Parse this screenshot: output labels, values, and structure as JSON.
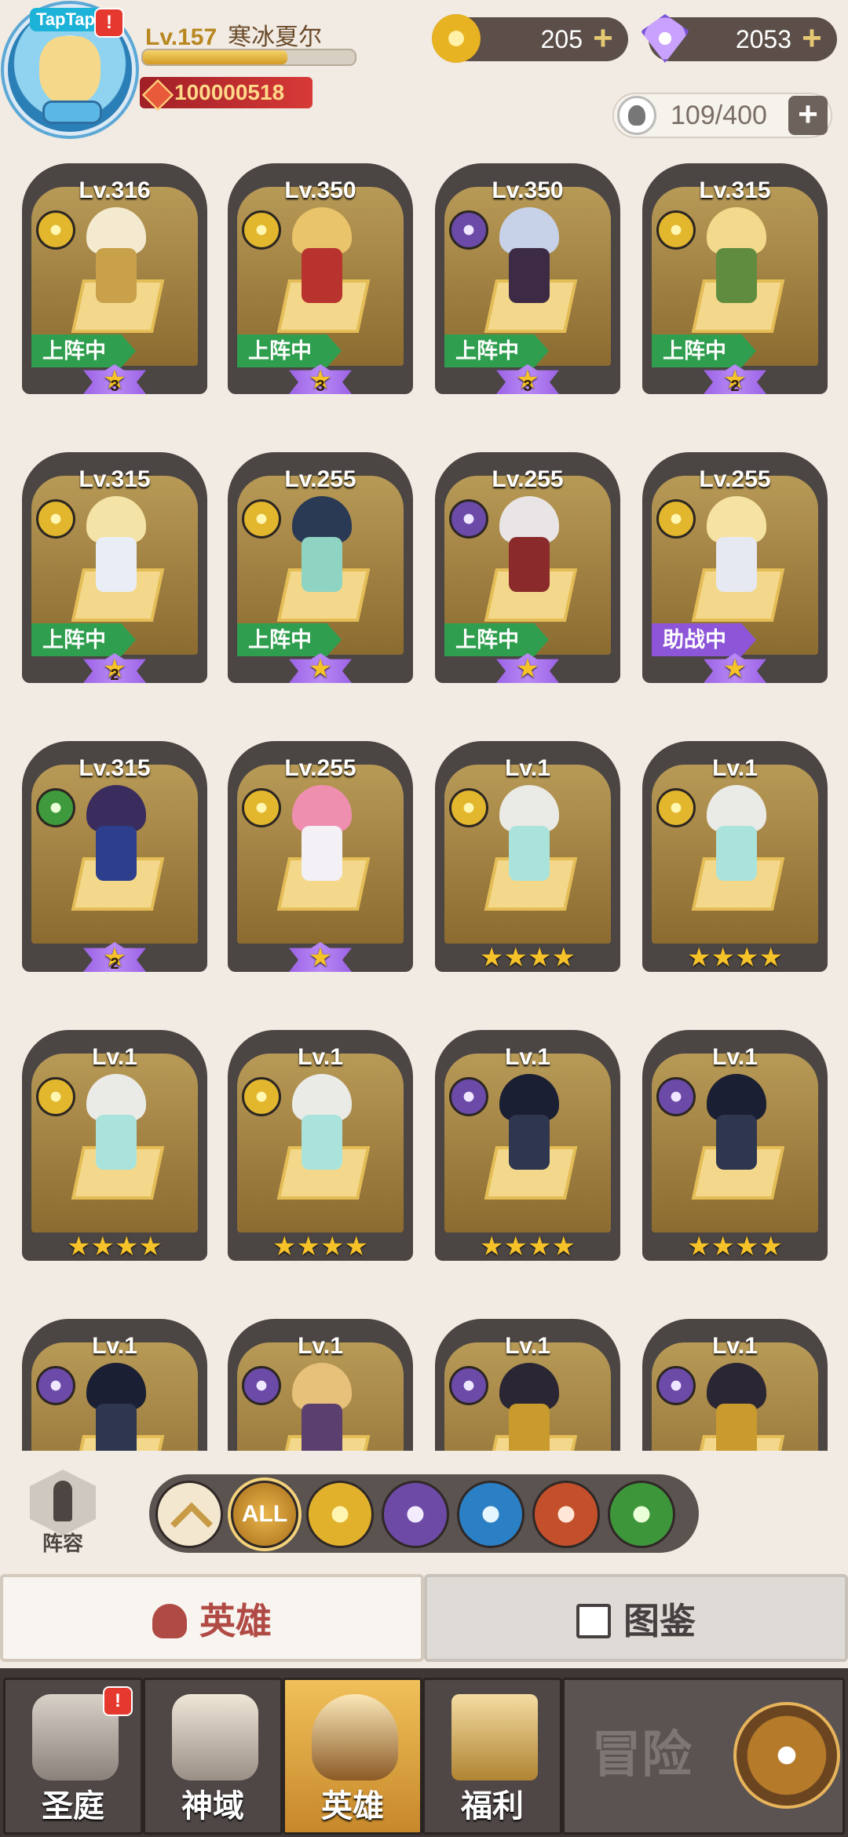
{
  "header": {
    "badge": "TapTap",
    "alert": "!",
    "level": "Lv.157",
    "player_name": "寒冰夏尔",
    "xp_fraction": 0.68,
    "combat_power": "100000518",
    "gold": "205",
    "diamonds": "2053",
    "hero_slots": "109/400",
    "plus": "+"
  },
  "heroes": [
    {
      "level": "Lv.316",
      "faction": "holy",
      "status": "上阵中",
      "status_type": "deploy",
      "star_type": "purple",
      "stars": "3",
      "hair": "#f3ead0",
      "body": "#c9a14a"
    },
    {
      "level": "Lv.350",
      "faction": "holy",
      "status": "上阵中",
      "status_type": "deploy",
      "star_type": "purple",
      "stars": "3",
      "hair": "#e9c46a",
      "body": "#b8322e"
    },
    {
      "level": "Lv.350",
      "faction": "dark",
      "status": "上阵中",
      "status_type": "deploy",
      "star_type": "purple",
      "stars": "3",
      "hair": "#c7d1e8",
      "body": "#3d2b46"
    },
    {
      "level": "Lv.315",
      "faction": "holy",
      "status": "上阵中",
      "status_type": "deploy",
      "star_type": "purple",
      "stars": "2",
      "hair": "#f2d98c",
      "body": "#5f8c3f"
    },
    {
      "level": "Lv.315",
      "faction": "holy",
      "status": "上阵中",
      "status_type": "deploy",
      "star_type": "purple",
      "stars": "2",
      "hair": "#f4e3a6",
      "body": "#e9edf6"
    },
    {
      "level": "Lv.255",
      "faction": "holy",
      "status": "上阵中",
      "status_type": "deploy",
      "star_type": "purple",
      "stars": "★",
      "hair": "#2a3a55",
      "body": "#8fd3c2"
    },
    {
      "level": "Lv.255",
      "faction": "dark",
      "status": "上阵中",
      "status_type": "deploy",
      "star_type": "purple",
      "stars": "★",
      "hair": "#e9e4e6",
      "body": "#8a2a2a"
    },
    {
      "level": "Lv.255",
      "faction": "holy",
      "status": "助战中",
      "status_type": "assist",
      "star_type": "purple",
      "stars": "★",
      "hair": "#f6e3a4",
      "body": "#e6e9f2"
    },
    {
      "level": "Lv.315",
      "faction": "nature",
      "status": "",
      "status_type": "",
      "star_type": "purple",
      "stars": "2",
      "hair": "#3a2d5e",
      "body": "#2c3e8c"
    },
    {
      "level": "Lv.255",
      "faction": "holy",
      "status": "",
      "status_type": "",
      "star_type": "purple",
      "stars": "★",
      "hair": "#ef8fb0",
      "body": "#f3f0f6"
    },
    {
      "level": "Lv.1",
      "faction": "holy",
      "status": "",
      "status_type": "",
      "star_type": "gold",
      "stars": "★★★★",
      "hair": "#eaeae6",
      "body": "#a9e3dc"
    },
    {
      "level": "Lv.1",
      "faction": "holy",
      "status": "",
      "status_type": "",
      "star_type": "gold",
      "stars": "★★★★",
      "hair": "#eaeae6",
      "body": "#a9e3dc"
    },
    {
      "level": "Lv.1",
      "faction": "holy",
      "status": "",
      "status_type": "",
      "star_type": "gold",
      "stars": "★★★★",
      "hair": "#eaeae6",
      "body": "#a9e3dc"
    },
    {
      "level": "Lv.1",
      "faction": "holy",
      "status": "",
      "status_type": "",
      "star_type": "gold",
      "stars": "★★★★",
      "hair": "#eaeae6",
      "body": "#a9e3dc"
    },
    {
      "level": "Lv.1",
      "faction": "dark",
      "status": "",
      "status_type": "",
      "star_type": "gold",
      "stars": "★★★★",
      "hair": "#1b1f33",
      "body": "#2e3650"
    },
    {
      "level": "Lv.1",
      "faction": "dark",
      "status": "",
      "status_type": "",
      "star_type": "gold",
      "stars": "★★★★",
      "hair": "#1b1f33",
      "body": "#2e3650"
    },
    {
      "level": "Lv.1",
      "faction": "dark",
      "status": "",
      "status_type": "",
      "star_type": "",
      "stars": "",
      "hair": "#1b1f33",
      "body": "#2e3650"
    },
    {
      "level": "Lv.1",
      "faction": "dark",
      "status": "",
      "status_type": "",
      "star_type": "",
      "stars": "",
      "hair": "#e7c07a",
      "body": "#5b3f6e"
    },
    {
      "level": "Lv.1",
      "faction": "dark",
      "status": "",
      "status_type": "",
      "star_type": "",
      "stars": "",
      "hair": "#2a2633",
      "body": "#c99a2e"
    },
    {
      "level": "Lv.1",
      "faction": "dark",
      "status": "",
      "status_type": "",
      "star_type": "",
      "stars": "",
      "hair": "#2a2633",
      "body": "#c99a2e"
    }
  ],
  "filter": {
    "lineup_label": "阵容",
    "all_label": "ALL"
  },
  "tabs": {
    "heroes": "英雄",
    "codex": "图鉴"
  },
  "nav": {
    "items": [
      {
        "label": "圣庭",
        "alert": "!"
      },
      {
        "label": "神域",
        "alert": ""
      },
      {
        "label": "英雄",
        "alert": ""
      },
      {
        "label": "福利",
        "alert": ""
      }
    ],
    "adventure": "冒险"
  },
  "colors": {
    "deploy": "#2f9e4e",
    "assist": "#8d55d8",
    "background": "#f1ebe3"
  }
}
